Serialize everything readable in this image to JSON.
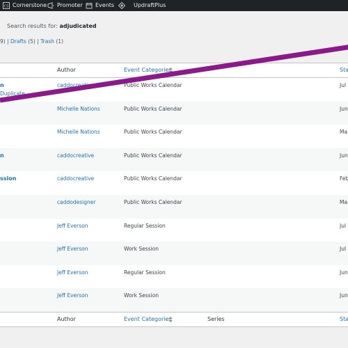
{
  "admin_bar": {
    "items": [
      {
        "label": "Cornerstone",
        "icon": "cornerstone-icon"
      },
      {
        "label": "Promoter",
        "icon": "promoter-icon"
      },
      {
        "label": "Events",
        "icon": "calendar-icon"
      },
      {
        "label": "UpdraftPlus",
        "icon": "updraftplus-icon"
      }
    ]
  },
  "search": {
    "prefix": "Search results for:",
    "term": "adjudicated"
  },
  "views": {
    "all_count_fragment": "9)",
    "sep": "|",
    "drafts_label": "Drafts",
    "drafts_count": "(5)",
    "trash_label": "Trash",
    "trash_count": "(1)"
  },
  "table": {
    "columns": {
      "author": "Author",
      "event_categories": "Event Categories",
      "series": "Series",
      "start_fragment": "Sta"
    },
    "rows": [
      {
        "title_fragment": "n",
        "action_fragment": "Duplicate",
        "author": "caddocreative",
        "category": "Public Works Calendar",
        "start_fragment": "Jul"
      },
      {
        "title_fragment": "",
        "action_fragment": "",
        "author": "Michelle Nations",
        "category": "Public Works Calendar",
        "start_fragment": "Jun"
      },
      {
        "title_fragment": "",
        "action_fragment": "",
        "author": "Michelle Nations",
        "category": "Public Works Calendar",
        "start_fragment": "Ma"
      },
      {
        "title_fragment": "n",
        "action_fragment": "",
        "author": "caddocreative",
        "category": "Public Works Calendar",
        "start_fragment": "Jun"
      },
      {
        "title_fragment": "ssion",
        "action_fragment": "",
        "author": "caddocreative",
        "category": "Public Works Calendar",
        "start_fragment": "Feb"
      },
      {
        "title_fragment": "",
        "action_fragment": "",
        "author": "caddodesigner",
        "category": "Public Works Calendar",
        "start_fragment": "Ma"
      },
      {
        "title_fragment": "",
        "action_fragment": "",
        "author": "Jeff Everson",
        "category": "Regular Session",
        "start_fragment": "Jul"
      },
      {
        "title_fragment": "",
        "action_fragment": "",
        "author": "Jeff Everson",
        "category": "Work Session",
        "start_fragment": "Jul"
      },
      {
        "title_fragment": "",
        "action_fragment": "",
        "author": "Jeff Everson",
        "category": "Regular Session",
        "start_fragment": "Jun"
      },
      {
        "title_fragment": "",
        "action_fragment": "",
        "author": "Jeff Everson",
        "category": "Work Session",
        "start_fragment": "Jun"
      }
    ]
  },
  "colors": {
    "admin_bar_bg": "#1d2327",
    "link": "#2271b1",
    "overlay_stroke": "#8a1a8a"
  }
}
